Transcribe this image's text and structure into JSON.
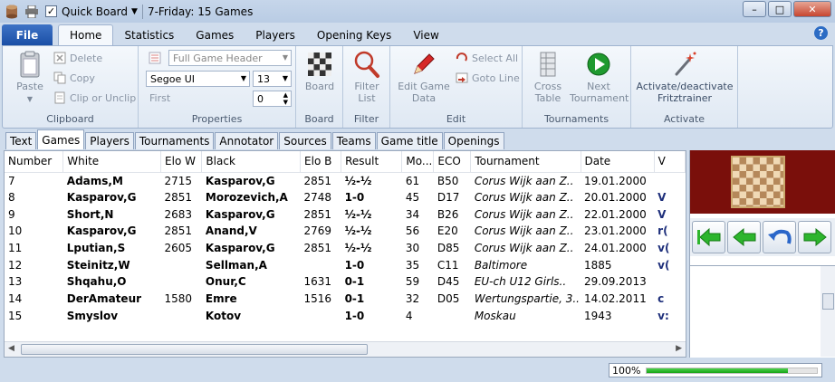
{
  "titlebar": {
    "quickboard_label": "Quick Board",
    "quickboard_checked": "✓",
    "window_title": "7-Friday:  15 Games",
    "min": "–",
    "max": "□",
    "close": "✕"
  },
  "ribbon_tabs": {
    "file": "File",
    "tabs": [
      "Home",
      "Statistics",
      "Games",
      "Players",
      "Opening Keys",
      "View"
    ],
    "help": "?"
  },
  "ribbon": {
    "clipboard": {
      "paste": "Paste",
      "delete": "Delete",
      "copy": "Copy",
      "clip": "Clip or Unclip",
      "label": "Clipboard"
    },
    "properties": {
      "header_combo": "Full Game Header",
      "font_combo": "Segoe UI",
      "size_combo": "13",
      "first_label": "First",
      "first_value": "0",
      "label": "Properties"
    },
    "board": {
      "button": "Board",
      "label": "Board"
    },
    "filter": {
      "button_line1": "Filter",
      "button_line2": "List",
      "label": "Filter"
    },
    "edit": {
      "edit_line1": "Edit Game",
      "edit_line2": "Data",
      "select_all": "Select All",
      "goto_line": "Goto Line",
      "label": "Edit"
    },
    "tournaments": {
      "cross_line1": "Cross",
      "cross_line2": "Table",
      "next_line1": "Next",
      "next_line2": "Tournament",
      "label": "Tournaments"
    },
    "activate": {
      "btn_line1": "Activate/deactivate",
      "btn_line2": "Fritztrainer",
      "label": "Activate"
    }
  },
  "doc_tabs": [
    "Text",
    "Games",
    "Players",
    "Tournaments",
    "Annotator",
    "Sources",
    "Teams",
    "Game title",
    "Openings"
  ],
  "grid": {
    "columns": [
      "Number",
      "White",
      "Elo W",
      "Black",
      "Elo B",
      "Result",
      "Mo...",
      "ECO",
      "Tournament",
      "Date",
      "V"
    ],
    "rows": [
      [
        "7",
        "Adams,M",
        "2715",
        "Kasparov,G",
        "2851",
        "½-½",
        "61",
        "B50",
        "Corus Wijk aan Z..",
        "19.01.2000",
        ""
      ],
      [
        "8",
        "Kasparov,G",
        "2851",
        "Morozevich,A",
        "2748",
        "1-0",
        "45",
        "D17",
        "Corus Wijk aan Z..",
        "20.01.2000",
        "V"
      ],
      [
        "9",
        "Short,N",
        "2683",
        "Kasparov,G",
        "2851",
        "½-½",
        "34",
        "B26",
        "Corus Wijk aan Z..",
        "22.01.2000",
        "V"
      ],
      [
        "10",
        "Kasparov,G",
        "2851",
        "Anand,V",
        "2769",
        "½-½",
        "56",
        "E20",
        "Corus Wijk aan Z..",
        "23.01.2000",
        "r("
      ],
      [
        "11",
        "Lputian,S",
        "2605",
        "Kasparov,G",
        "2851",
        "½-½",
        "30",
        "D85",
        "Corus Wijk aan Z..",
        "24.01.2000",
        "v("
      ],
      [
        "12",
        "Steinitz,W",
        "",
        "Sellman,A",
        "",
        "1-0",
        "35",
        "C11",
        "Baltimore",
        "1885",
        "v("
      ],
      [
        "13",
        "Shqahu,O",
        "",
        "Onur,C",
        "1631",
        "0-1",
        "59",
        "D45",
        "EU-ch U12 Girls..",
        "29.09.2013",
        ""
      ],
      [
        "14",
        "DerAmateur",
        "1580",
        "Emre",
        "1516",
        "0-1",
        "32",
        "D05",
        "Wertungspartie, 3..",
        "14.02.2011",
        "c"
      ],
      [
        "15",
        "Smyslov",
        "",
        "Kotov",
        "",
        "1-0",
        "4",
        "",
        "Moskau",
        "1943",
        "v:"
      ]
    ]
  },
  "status": {
    "progress_text": "100%",
    "progress_fraction": 0.83
  }
}
